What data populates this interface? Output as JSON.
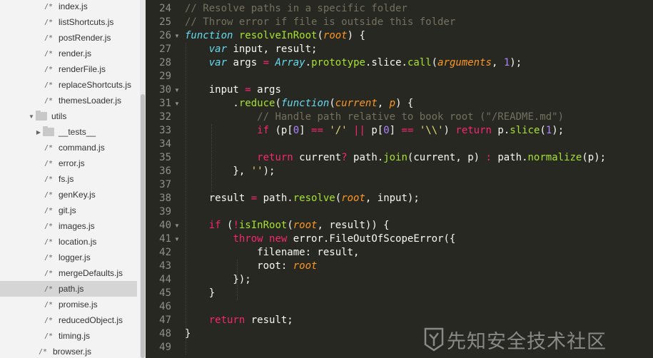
{
  "sidebar": {
    "items": [
      {
        "type": "file",
        "label": "index.js"
      },
      {
        "type": "file",
        "label": "listShortcuts.js"
      },
      {
        "type": "file",
        "label": "postRender.js"
      },
      {
        "type": "file",
        "label": "render.js"
      },
      {
        "type": "file",
        "label": "renderFile.js"
      },
      {
        "type": "file",
        "label": "replaceShortcuts.js"
      },
      {
        "type": "file",
        "label": "themesLoader.js"
      },
      {
        "type": "folder-open",
        "label": "utils"
      },
      {
        "type": "folder-closed",
        "label": "__tests__"
      },
      {
        "type": "file",
        "label": "command.js"
      },
      {
        "type": "file",
        "label": "error.js"
      },
      {
        "type": "file",
        "label": "fs.js"
      },
      {
        "type": "file",
        "label": "genKey.js"
      },
      {
        "type": "file",
        "label": "git.js"
      },
      {
        "type": "file",
        "label": "images.js"
      },
      {
        "type": "file",
        "label": "location.js"
      },
      {
        "type": "file",
        "label": "logger.js"
      },
      {
        "type": "file",
        "label": "mergeDefaults.js"
      },
      {
        "type": "file",
        "label": "path.js",
        "selected": true
      },
      {
        "type": "file",
        "label": "promise.js"
      },
      {
        "type": "file",
        "label": "reducedObject.js"
      },
      {
        "type": "file",
        "label": "timing.js"
      },
      {
        "type": "file",
        "label": "browser.js"
      }
    ],
    "file_glyph": "/*",
    "folder_open_caret": "▼",
    "folder_closed_caret": "▶"
  },
  "editor": {
    "fold_marker": "▼",
    "folded_lines": [
      26,
      30,
      31,
      40,
      41
    ],
    "lines": [
      {
        "n": "24",
        "tokens": [
          [
            "cm",
            "// Resolve paths in a specific folder"
          ]
        ]
      },
      {
        "n": "25",
        "tokens": [
          [
            "cm",
            "// Throw error if file is outside this folder"
          ]
        ]
      },
      {
        "n": "26",
        "tokens": [
          [
            "st",
            "function"
          ],
          [
            "pl",
            " "
          ],
          [
            "fn",
            "resolveInRoot"
          ],
          [
            "pl",
            "("
          ],
          [
            "pa",
            "root"
          ],
          [
            "pl",
            ") {"
          ]
        ]
      },
      {
        "n": "27",
        "tokens": [
          [
            "pl",
            "    "
          ],
          [
            "st",
            "var"
          ],
          [
            "pl",
            " input, result;"
          ]
        ]
      },
      {
        "n": "28",
        "tokens": [
          [
            "pl",
            "    "
          ],
          [
            "st",
            "var"
          ],
          [
            "pl",
            " args "
          ],
          [
            "kw",
            "="
          ],
          [
            "pl",
            " "
          ],
          [
            "st",
            "Array"
          ],
          [
            "pl",
            "."
          ],
          [
            "fn",
            "prototype"
          ],
          [
            "pl",
            "."
          ],
          [
            "pl",
            "slice"
          ],
          [
            "pl",
            "."
          ],
          [
            "fn",
            "call"
          ],
          [
            "pl",
            "("
          ],
          [
            "pa",
            "arguments"
          ],
          [
            "pl",
            ", "
          ],
          [
            "nm",
            "1"
          ],
          [
            "pl",
            ");"
          ]
        ]
      },
      {
        "n": "29",
        "tokens": []
      },
      {
        "n": "30",
        "tokens": [
          [
            "pl",
            "    input "
          ],
          [
            "kw",
            "="
          ],
          [
            "pl",
            " args"
          ]
        ]
      },
      {
        "n": "31",
        "tokens": [
          [
            "pl",
            "        ."
          ],
          [
            "fn",
            "reduce"
          ],
          [
            "pl",
            "("
          ],
          [
            "st",
            "function"
          ],
          [
            "pl",
            "("
          ],
          [
            "pa",
            "current"
          ],
          [
            "pl",
            ", "
          ],
          [
            "pa",
            "p"
          ],
          [
            "pl",
            ") {"
          ]
        ]
      },
      {
        "n": "32",
        "tokens": [
          [
            "pl",
            "            "
          ],
          [
            "cm",
            "// Handle path relative to book root (\"/README.md\")"
          ]
        ]
      },
      {
        "n": "33",
        "tokens": [
          [
            "pl",
            "            "
          ],
          [
            "kw",
            "if"
          ],
          [
            "pl",
            " (p["
          ],
          [
            "nm",
            "0"
          ],
          [
            "pl",
            "] "
          ],
          [
            "kw",
            "=="
          ],
          [
            "pl",
            " "
          ],
          [
            "s",
            "'/'"
          ],
          [
            "pl",
            " "
          ],
          [
            "kw",
            "||"
          ],
          [
            "pl",
            " p["
          ],
          [
            "nm",
            "0"
          ],
          [
            "pl",
            "] "
          ],
          [
            "kw",
            "=="
          ],
          [
            "pl",
            " "
          ],
          [
            "s",
            "'\\\\'"
          ],
          [
            "pl",
            ") "
          ],
          [
            "kw",
            "return"
          ],
          [
            "pl",
            " p."
          ],
          [
            "fn",
            "slice"
          ],
          [
            "pl",
            "("
          ],
          [
            "nm",
            "1"
          ],
          [
            "pl",
            ");"
          ]
        ]
      },
      {
        "n": "34",
        "tokens": []
      },
      {
        "n": "35",
        "tokens": [
          [
            "pl",
            "            "
          ],
          [
            "kw",
            "return"
          ],
          [
            "pl",
            " current"
          ],
          [
            "kw",
            "?"
          ],
          [
            "pl",
            " path."
          ],
          [
            "fn",
            "join"
          ],
          [
            "pl",
            "(current, p) "
          ],
          [
            "kw",
            ":"
          ],
          [
            "pl",
            " path."
          ],
          [
            "fn",
            "normalize"
          ],
          [
            "pl",
            "(p);"
          ]
        ]
      },
      {
        "n": "36",
        "tokens": [
          [
            "pl",
            "        }, "
          ],
          [
            "s",
            "''"
          ],
          [
            "pl",
            ");"
          ]
        ]
      },
      {
        "n": "37",
        "tokens": []
      },
      {
        "n": "38",
        "tokens": [
          [
            "pl",
            "    result "
          ],
          [
            "kw",
            "="
          ],
          [
            "pl",
            " path."
          ],
          [
            "fn",
            "resolve"
          ],
          [
            "pl",
            "("
          ],
          [
            "pa",
            "root"
          ],
          [
            "pl",
            ", input);"
          ]
        ]
      },
      {
        "n": "39",
        "tokens": []
      },
      {
        "n": "40",
        "tokens": [
          [
            "pl",
            "    "
          ],
          [
            "kw",
            "if"
          ],
          [
            "pl",
            " ("
          ],
          [
            "kw",
            "!"
          ],
          [
            "fn",
            "isInRoot"
          ],
          [
            "pl",
            "("
          ],
          [
            "pa",
            "root"
          ],
          [
            "pl",
            ", result)) {"
          ]
        ]
      },
      {
        "n": "41",
        "tokens": [
          [
            "pl",
            "        "
          ],
          [
            "kw",
            "throw"
          ],
          [
            "pl",
            " "
          ],
          [
            "kw",
            "new"
          ],
          [
            "pl",
            " error."
          ],
          [
            "pl",
            "FileOutOfScopeError({"
          ]
        ]
      },
      {
        "n": "42",
        "tokens": [
          [
            "pl",
            "            filename: result,"
          ]
        ]
      },
      {
        "n": "43",
        "tokens": [
          [
            "pl",
            "            root: "
          ],
          [
            "pa",
            "root"
          ]
        ]
      },
      {
        "n": "44",
        "tokens": [
          [
            "pl",
            "        });"
          ]
        ]
      },
      {
        "n": "45",
        "tokens": [
          [
            "pl",
            "    }"
          ]
        ]
      },
      {
        "n": "46",
        "tokens": []
      },
      {
        "n": "47",
        "tokens": [
          [
            "pl",
            "    "
          ],
          [
            "kw",
            "return"
          ],
          [
            "pl",
            " result;"
          ]
        ]
      },
      {
        "n": "48",
        "tokens": [
          [
            "pl",
            "}"
          ]
        ]
      },
      {
        "n": "49",
        "tokens": []
      }
    ]
  },
  "watermark": {
    "text": "先知安全技术社区"
  },
  "colors": {
    "editor_bg": "#272822",
    "comment": "#75715e",
    "keyword": "#f92672",
    "storage": "#66d9ef",
    "function": "#a6e22e",
    "parameter": "#fd971f",
    "number": "#ae81ff",
    "string": "#e6db74",
    "sidebar_bg": "#f3f3f3",
    "selected_row": "#d5d5d5"
  }
}
